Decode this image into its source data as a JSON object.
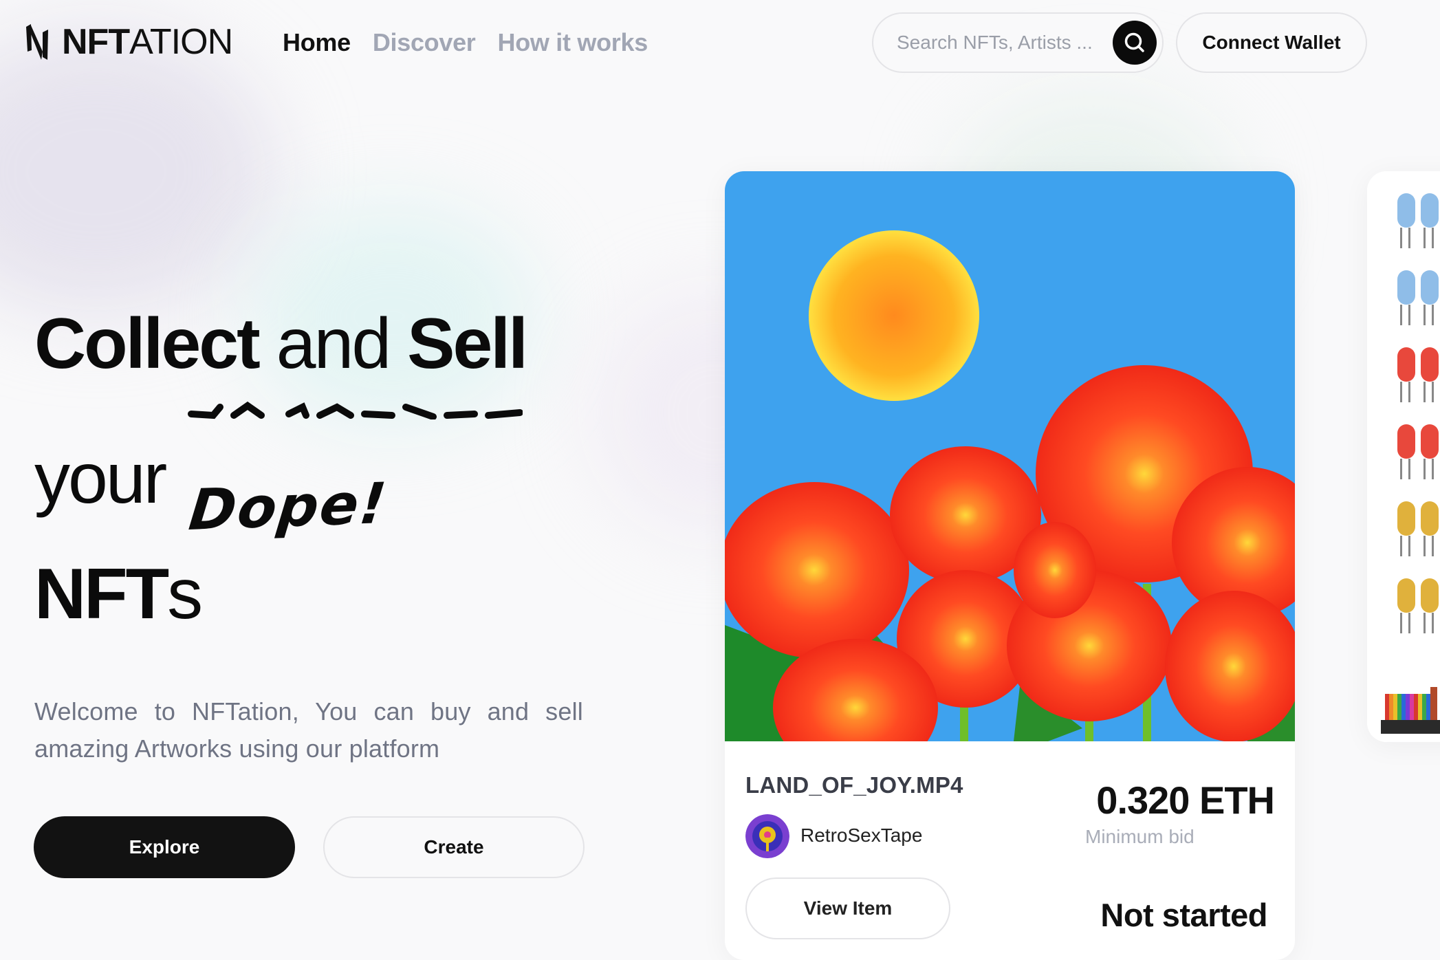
{
  "brand": {
    "logo_bold": "NFT",
    "logo_thin": "ATION"
  },
  "nav": {
    "links": [
      {
        "label": "Home",
        "active": true
      },
      {
        "label": "Discover",
        "active": false
      },
      {
        "label": "How it works",
        "active": false
      }
    ]
  },
  "search": {
    "placeholder": "Search NFTs, Artists ..."
  },
  "header": {
    "connect_label": "Connect Wallet"
  },
  "hero": {
    "word_collect": "Collect",
    "word_and": "and",
    "word_sell": "Sell",
    "word_your": "your",
    "handwritten": "Dope!",
    "word_nft": "NFT",
    "word_s": "s",
    "description": "Welcome to NFTation, You can buy and sell amazing Artworks using our platform",
    "explore_label": "Explore",
    "create_label": "Create"
  },
  "featured": {
    "title": "LAND_OF_JOY.MP4",
    "creator": "RetroSexTape",
    "price": "0.320 ETH",
    "price_label": "Minimum bid",
    "view_label": "View Item",
    "status": "Not started"
  },
  "colors": {
    "primary_dark": "#121212",
    "muted_nav": "#a1a6b4",
    "sky": "#3ea2ee",
    "flower_red": "#ff4a22",
    "sun": "#ffb321"
  }
}
